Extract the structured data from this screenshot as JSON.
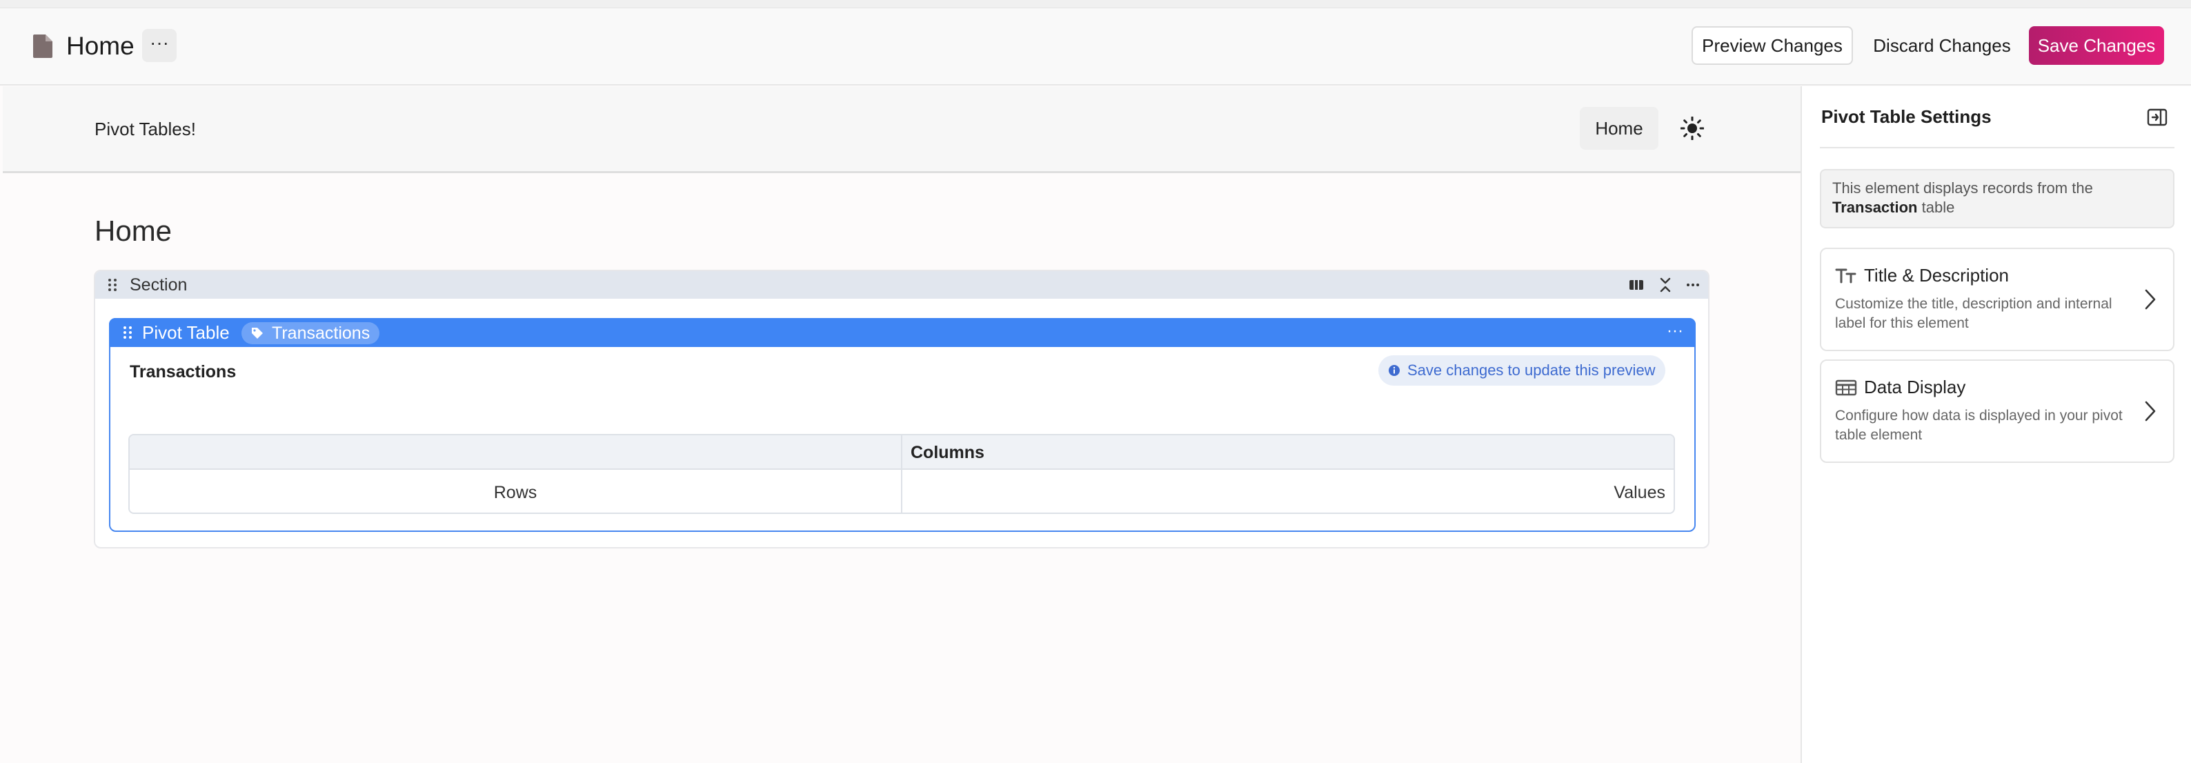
{
  "header": {
    "page_name": "Home",
    "more_label": "···",
    "preview_label": "Preview Changes",
    "discard_label": "Discard Changes",
    "save_label": "Save Changes"
  },
  "app": {
    "title": "Pivot Tables!",
    "nav_home": "Home"
  },
  "page": {
    "heading": "Home"
  },
  "section": {
    "label": "Section"
  },
  "pivot": {
    "label": "Pivot Table",
    "tag": "Transactions",
    "more_label": "···",
    "title": "Transactions",
    "notice": "Save changes to update this preview",
    "table": {
      "columns_header": "Columns",
      "rows_label": "Rows",
      "values_label": "Values"
    }
  },
  "panel": {
    "title": "Pivot Table Settings",
    "info_prefix": "This element displays records from the",
    "info_table": "Transaction",
    "info_suffix": "table",
    "cards": [
      {
        "title": "Title & Description",
        "description": "Customize the title, description and internal label for this element",
        "icon": "text-format-icon"
      },
      {
        "title": "Data Display",
        "description": "Configure how data is displayed in your pivot table element",
        "icon": "table-icon"
      }
    ]
  },
  "colors": {
    "accent_blue": "#3f85f4",
    "save_gradient_start": "#b41d6c",
    "save_gradient_end": "#e41e7a",
    "notice_text": "#3e6bd0"
  }
}
